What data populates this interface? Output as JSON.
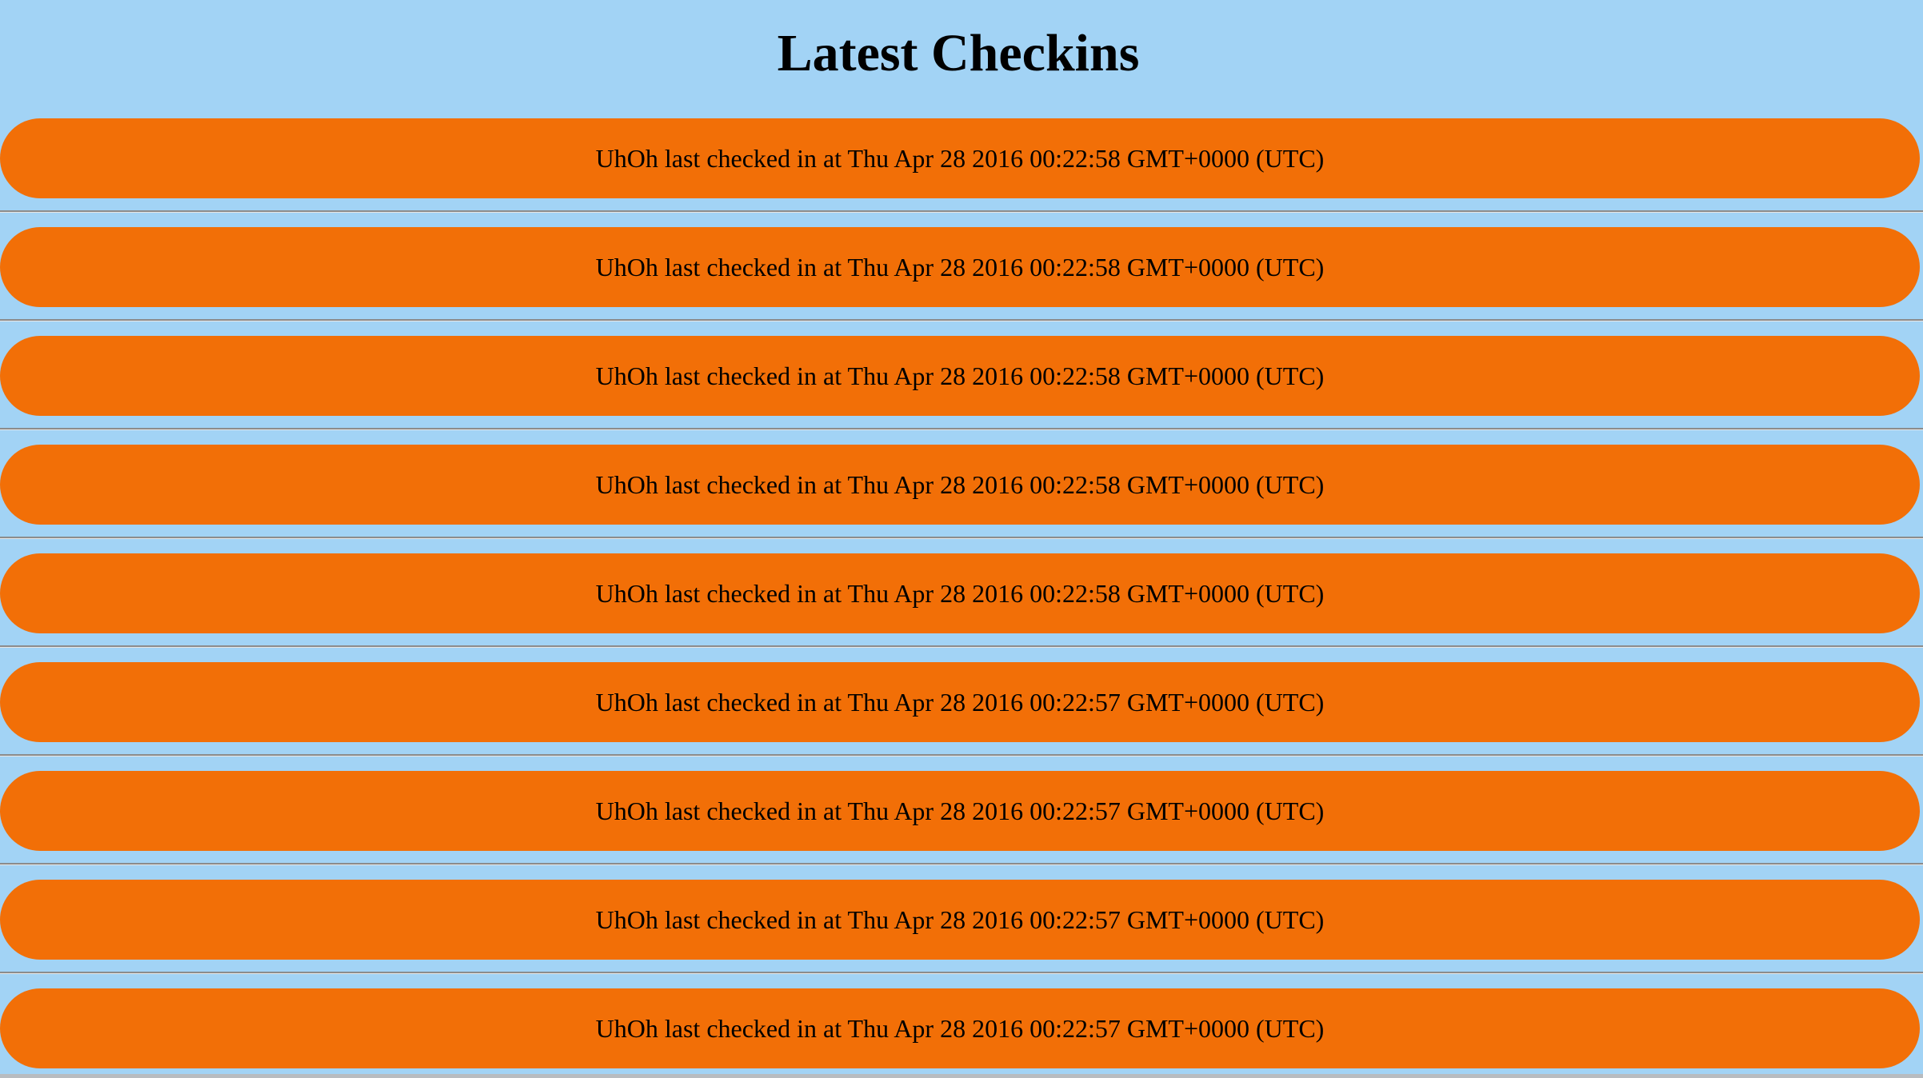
{
  "header": {
    "title": "Latest Checkins"
  },
  "checkins": [
    {
      "text": "UhOh last checked in at Thu Apr 28 2016 00:22:58 GMT+0000 (UTC)"
    },
    {
      "text": "UhOh last checked in at Thu Apr 28 2016 00:22:58 GMT+0000 (UTC)"
    },
    {
      "text": "UhOh last checked in at Thu Apr 28 2016 00:22:58 GMT+0000 (UTC)"
    },
    {
      "text": "UhOh last checked in at Thu Apr 28 2016 00:22:58 GMT+0000 (UTC)"
    },
    {
      "text": "UhOh last checked in at Thu Apr 28 2016 00:22:58 GMT+0000 (UTC)"
    },
    {
      "text": "UhOh last checked in at Thu Apr 28 2016 00:22:57 GMT+0000 (UTC)"
    },
    {
      "text": "UhOh last checked in at Thu Apr 28 2016 00:22:57 GMT+0000 (UTC)"
    },
    {
      "text": "UhOh last checked in at Thu Apr 28 2016 00:22:57 GMT+0000 (UTC)"
    },
    {
      "text": "UhOh last checked in at Thu Apr 28 2016 00:22:57 GMT+0000 (UTC)"
    }
  ],
  "colors": {
    "background": "#a2d3f5",
    "pill": "#f26f07"
  }
}
